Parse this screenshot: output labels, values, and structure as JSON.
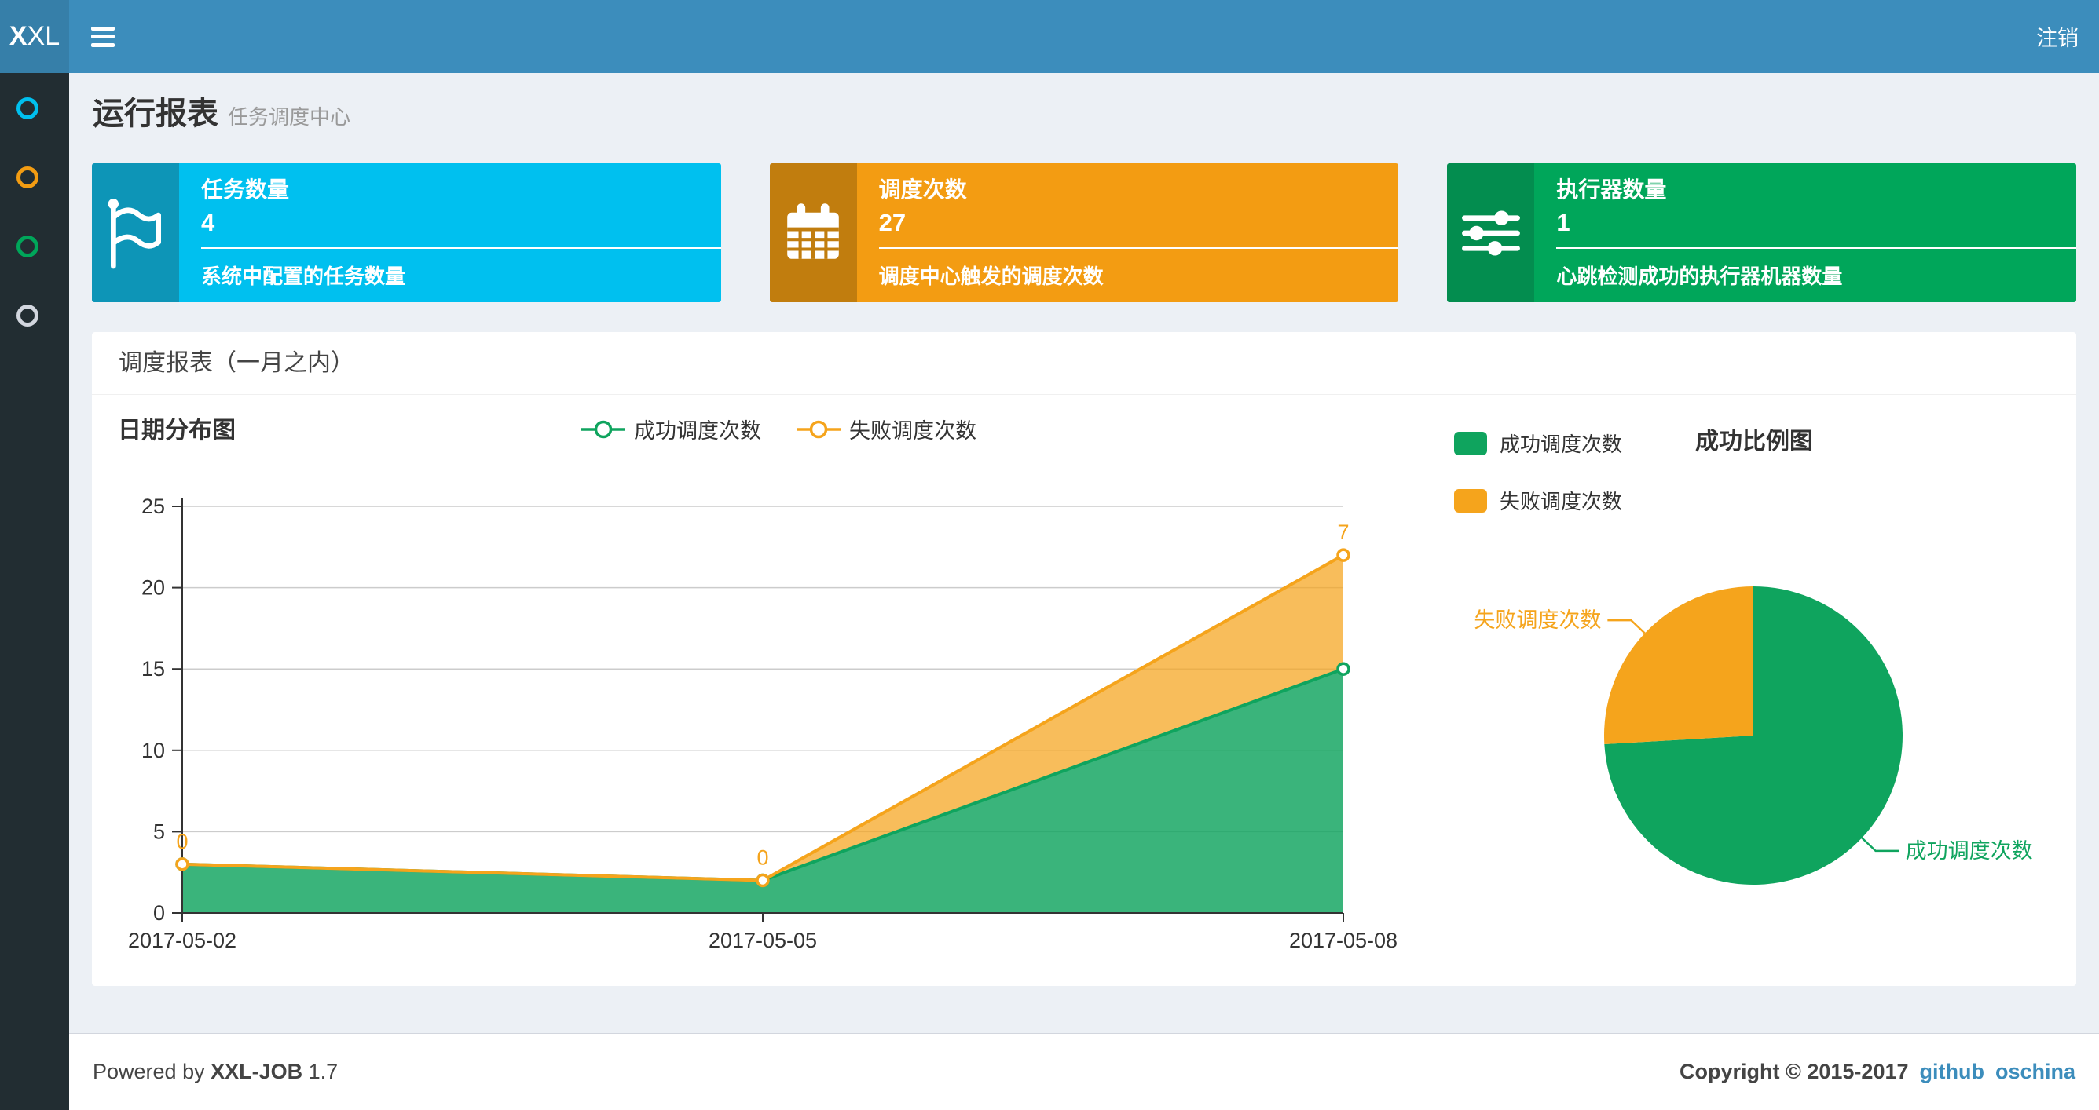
{
  "navbar": {
    "logo_primary": "X",
    "logo_secondary": "XL",
    "logout_label": "注销"
  },
  "sidebar": {
    "items": [
      {
        "icon": "circle-outline-icon",
        "color": "#00c0ef"
      },
      {
        "icon": "circle-outline-icon",
        "color": "#f39c12"
      },
      {
        "icon": "circle-outline-icon",
        "color": "#00a65a"
      },
      {
        "icon": "circle-outline-icon",
        "color": "#d2d6de"
      }
    ]
  },
  "header": {
    "title": "运行报表",
    "subtitle": "任务调度中心"
  },
  "stats": [
    {
      "label": "任务数量",
      "value": "4",
      "desc": "系统中配置的任务数量",
      "icon": "flag-icon",
      "bg": "#00c0ef",
      "icon_bg": "#0d95b7"
    },
    {
      "label": "调度次数",
      "value": "27",
      "desc": "调度中心触发的调度次数",
      "icon": "calendar-icon",
      "bg": "#f39c12",
      "icon_bg": "#c17d0e"
    },
    {
      "label": "执行器数量",
      "value": "1",
      "desc": "心跳检测成功的执行器机器数量",
      "icon": "sliders-icon",
      "bg": "#00a65a",
      "icon_bg": "#038d4f"
    }
  ],
  "panel": {
    "title": "调度报表（一月之内）"
  },
  "chart_data": [
    {
      "type": "area",
      "title": "日期分布图",
      "x": [
        "2017-05-02",
        "2017-05-05",
        "2017-05-08"
      ],
      "series": [
        {
          "name": "成功调度次数",
          "values": [
            3,
            2,
            15
          ],
          "color": "#0fa45e"
        },
        {
          "name": "失败调度次数",
          "values": [
            0,
            0,
            7
          ],
          "color": "#f5a41c",
          "point_labels": [
            "0",
            "0",
            "7"
          ]
        }
      ],
      "stacked": true,
      "ylim": [
        0,
        25
      ],
      "yticks": [
        0,
        5,
        10,
        15,
        20,
        25
      ],
      "grid": true,
      "legend_position": "top-center"
    },
    {
      "type": "pie",
      "title": "成功比例图",
      "slices": [
        {
          "label": "成功调度次数",
          "value": 20,
          "color": "#0fa45e"
        },
        {
          "label": "失败调度次数",
          "value": 7,
          "color": "#f5a41c"
        }
      ],
      "start_angle": "top",
      "legend_position": "left"
    }
  ],
  "footer": {
    "powered_by": "Powered by",
    "product": "XXL-JOB",
    "version": "1.7",
    "copyright": "Copyright © 2015-2017",
    "links": [
      "github",
      "oschina"
    ]
  }
}
